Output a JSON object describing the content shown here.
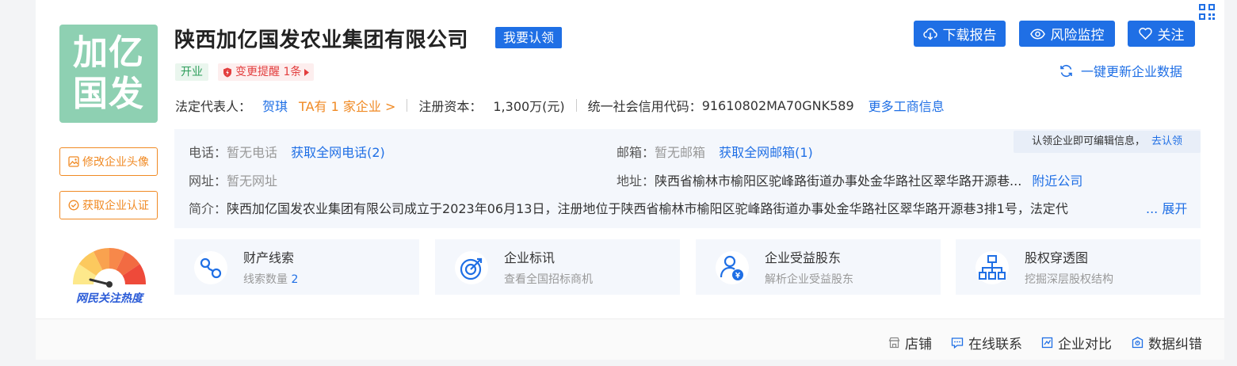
{
  "company": {
    "logo_text_line1": "加亿",
    "logo_text_line2": "国发",
    "name": "陕西加亿国发农业集团有限公司",
    "claim_label": "我要认领",
    "status_tag": "开业",
    "change_alert": "变更提醒 1条"
  },
  "side": {
    "edit_avatar": "修改企业头像",
    "get_cert": "获取企业认证",
    "heat_label": "网民关注热度"
  },
  "info": {
    "legal_rep_label": "法定代表人：",
    "legal_rep_name": "贺琪",
    "ta_link": "TA有 1 家企业 >",
    "capital_label": "注册资本：",
    "capital_value": "1,300万(元)",
    "credit_label": "统一社会信用代码：",
    "credit_value": "91610802MA70GNK589",
    "more_link": "更多工商信息"
  },
  "actions": {
    "download": "下载报告",
    "monitor": "风险监控",
    "follow": "关注",
    "refresh": "一键更新企业数据"
  },
  "contact": {
    "phone_label": "电话：",
    "phone_value": "暂无电话",
    "phone_link": "获取全网电话(2)",
    "email_label": "邮箱：",
    "email_value": "暂无邮箱",
    "email_link": "获取全网邮箱(1)",
    "website_label": "网址：",
    "website_value": "暂无网址",
    "address_label": "地址：",
    "address_value": "陕西省榆林市榆阳区驼峰路街道办事处金华路社区翠华路开源巷...",
    "address_link": "附近公司",
    "intro_label": "简介：",
    "intro_value": "陕西加亿国发农业集团有限公司成立于2023年06月13日，注册地位于陕西省榆林市榆阳区驼峰路街道办事处金华路社区翠华路开源巷3排1号，法定代",
    "intro_more": "... 展开",
    "tooltip_text": "认领企业即可编辑信息，",
    "tooltip_link": "去认领"
  },
  "features": [
    {
      "title": "财产线索",
      "sub_prefix": "线索数量 ",
      "sub_value": "2"
    },
    {
      "title": "企业标讯",
      "sub_prefix": "查看全国招标商机",
      "sub_value": ""
    },
    {
      "title": "企业受益股东",
      "sub_prefix": "解析企业受益股东",
      "sub_value": ""
    },
    {
      "title": "股权穿透图",
      "sub_prefix": "挖掘深层股权结构",
      "sub_value": ""
    }
  ],
  "footer": {
    "shop": "店铺",
    "online": "在线联系",
    "compare": "企业对比",
    "correct": "数据纠错"
  },
  "colors": {
    "accent": "#1f6fe5",
    "orange": "#f08a24",
    "logo_bg": "#8ed0b2",
    "alert_red": "#e33e3e",
    "open_green": "#2f9e5c"
  }
}
